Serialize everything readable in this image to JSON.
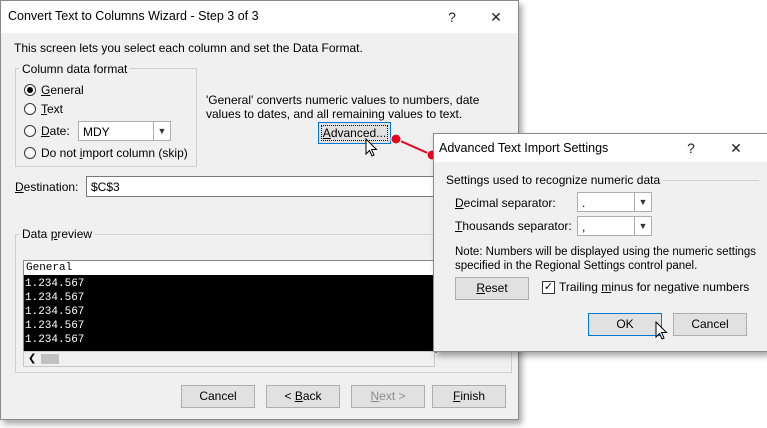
{
  "wizard": {
    "title": "Convert Text to Columns Wizard - Step 3 of 3",
    "help_glyph": "?",
    "close_glyph": "✕",
    "intro": "This screen lets you select each column and set the Data Format.",
    "format_group": {
      "legend": "Column data format",
      "options": [
        {
          "prefix": "",
          "accel": "G",
          "rest": "eneral",
          "checked": true
        },
        {
          "prefix": "",
          "accel": "T",
          "rest": "ext",
          "checked": false
        },
        {
          "prefix": "",
          "accel": "D",
          "rest": "ate:",
          "checked": false
        },
        {
          "prefix": "Do not ",
          "accel": "i",
          "rest": "mport column (skip)",
          "checked": false
        }
      ],
      "date_format": "MDY"
    },
    "description": "'General' converts numeric values to numbers, date values to dates, and all remaining values to text.",
    "advanced_button": {
      "prefix": "",
      "accel": "A",
      "rest": "dvanced..."
    },
    "destination": {
      "accel": "D",
      "rest": "estination:",
      "value": "$C$3"
    },
    "preview": {
      "label_prefix": "Data ",
      "label_accel": "p",
      "label_rest": "review",
      "header": "General",
      "rows": [
        "1.234.567",
        "1.234.567",
        "1.234.567",
        "1.234.567",
        "1.234.567"
      ]
    },
    "buttons": {
      "cancel": "Cancel",
      "back": {
        "prefix": "< ",
        "accel": "B",
        "rest": "ack"
      },
      "next": {
        "prefix": "",
        "accel": "N",
        "rest": "ext >"
      },
      "finish": {
        "prefix": "",
        "accel": "F",
        "rest": "inish"
      }
    }
  },
  "advanced_dialog": {
    "title": "Advanced Text Import Settings",
    "help_glyph": "?",
    "close_glyph": "✕",
    "group_legend": "Settings used to recognize numeric data",
    "decimal": {
      "accel": "D",
      "rest": "ecimal separator:",
      "value": "."
    },
    "thousands": {
      "accel": "T",
      "rest": "housands separator:",
      "value": ","
    },
    "note": "Note: Numbers will be displayed using the numeric settings specified in the Regional Settings control panel.",
    "reset": {
      "accel": "R",
      "rest": "eset"
    },
    "trailing_minus": {
      "label_pre": "Trailing ",
      "label_accel": "m",
      "label_rest": "inus for negative numbers",
      "checked": true,
      "mark": "✓"
    },
    "ok": "OK",
    "cancel": "Cancel"
  },
  "colors": {
    "window_bg": "#f0f0f0",
    "preview_bg": "#000000",
    "callout": "#e8001c",
    "focus_border": "#0078d7"
  }
}
